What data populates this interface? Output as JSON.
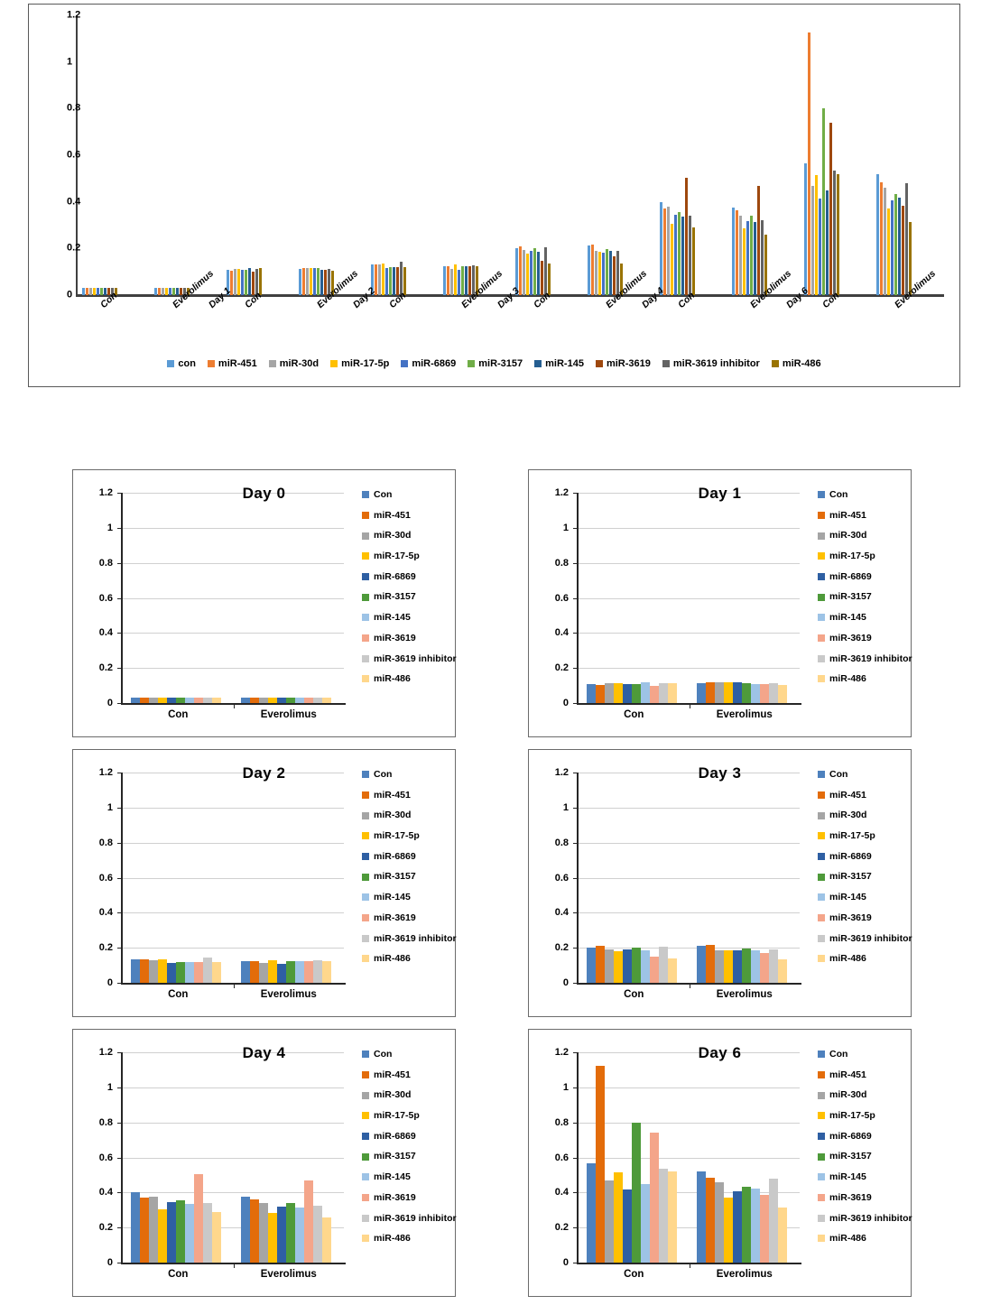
{
  "series_names_top": [
    "con",
    "miR-451",
    "miR-30d",
    "miR-17-5p",
    "miR-6869",
    "miR-3157",
    "miR-145",
    "miR-3619",
    "miR-3619 inhibitor",
    "miR-486"
  ],
  "series_names_sub": [
    "Con",
    "miR-451",
    "miR-30d",
    "miR-17-5p",
    "miR-6869",
    "miR-3157",
    "miR-145",
    "miR-3619",
    "miR-3619 inhibitor",
    "miR-486"
  ],
  "colors_top": [
    "#5B9BD5",
    "#ED7D31",
    "#A5A5A5",
    "#FFC000",
    "#4472C4",
    "#70AD47",
    "#255E91",
    "#9E480E",
    "#636363",
    "#997300"
  ],
  "colors_sub": [
    "#4E81BD",
    "#E36C0A",
    "#A5A5A5",
    "#FFC000",
    "#2E5FA3",
    "#4E9A3A",
    "#9DC3E6",
    "#F4A58A",
    "#C9C9C9",
    "#FFD78C"
  ],
  "y_ticks": [
    "0",
    "0.2",
    "0.4",
    "0.6",
    "0.8",
    "1",
    "1.2"
  ],
  "top_chart": {
    "x_labels": [
      "Con",
      "Everolimus",
      "Day 1",
      "Con",
      "Everolimus",
      "Day 2",
      "Con",
      "Everolimus",
      "Day 3",
      "Con",
      "Everolimus",
      "Day 4",
      "Con",
      "Everolimus",
      "Day 6",
      "Con",
      "Everolimus"
    ]
  },
  "chart_data": [
    {
      "type": "bar",
      "title": "",
      "xlabel": "",
      "ylabel": "",
      "ylim": [
        0,
        1.2
      ],
      "grid": false,
      "legend_position": "bottom",
      "categories": [
        "Day 0 Con",
        "Day 0 Everolimus",
        "Day 1 Con",
        "Day 1 Everolimus",
        "Day 2 Con",
        "Day 2 Everolimus",
        "Day 3 Con",
        "Day 3 Everolimus",
        "Day 4 Con",
        "Day 4 Everolimus",
        "Day 6 Con",
        "Day 6 Everolimus"
      ],
      "series": [
        {
          "name": "con",
          "values": [
            0.03,
            0.032,
            0.11,
            0.112,
            0.132,
            0.123,
            0.202,
            0.213,
            0.4,
            0.375,
            0.565,
            0.52
          ]
        },
        {
          "name": "miR-451",
          "values": [
            0.03,
            0.03,
            0.105,
            0.116,
            0.133,
            0.122,
            0.21,
            0.218,
            0.37,
            0.363,
            1.125,
            0.485
          ]
        },
        {
          "name": "miR-30d",
          "values": [
            0.031,
            0.031,
            0.112,
            0.116,
            0.131,
            0.112,
            0.193,
            0.188,
            0.378,
            0.34,
            0.47,
            0.46
          ]
        },
        {
          "name": "miR-17-5p",
          "values": [
            0.03,
            0.03,
            0.114,
            0.118,
            0.134,
            0.13,
            0.178,
            0.185,
            0.305,
            0.285,
            0.515,
            0.37
          ]
        },
        {
          "name": "miR-6869",
          "values": [
            0.031,
            0.031,
            0.108,
            0.118,
            0.115,
            0.108,
            0.19,
            0.183,
            0.345,
            0.318,
            0.415,
            0.405
          ]
        },
        {
          "name": "miR-3157",
          "values": [
            0.031,
            0.03,
            0.11,
            0.115,
            0.12,
            0.125,
            0.2,
            0.198,
            0.355,
            0.34,
            0.8,
            0.435
          ]
        },
        {
          "name": "miR-145",
          "values": [
            0.03,
            0.03,
            0.118,
            0.108,
            0.121,
            0.124,
            0.185,
            0.188,
            0.335,
            0.313,
            0.45,
            0.42
          ]
        },
        {
          "name": "miR-3619",
          "values": [
            0.03,
            0.031,
            0.1,
            0.11,
            0.12,
            0.124,
            0.148,
            0.168,
            0.505,
            0.468,
            0.74,
            0.385
          ]
        },
        {
          "name": "miR-3619 inhibitor",
          "values": [
            0.031,
            0.03,
            0.113,
            0.111,
            0.145,
            0.128,
            0.207,
            0.19,
            0.34,
            0.322,
            0.535,
            0.48
          ]
        },
        {
          "name": "miR-486",
          "values": [
            0.031,
            0.032,
            0.115,
            0.105,
            0.12,
            0.125,
            0.137,
            0.135,
            0.29,
            0.26,
            0.52,
            0.315
          ]
        }
      ]
    },
    {
      "type": "bar",
      "title": "Day 0",
      "ylim": [
        0,
        1.2
      ],
      "categories": [
        "Con",
        "Everolimus"
      ],
      "legend_position": "right",
      "grid": true,
      "series": [
        {
          "name": "Con",
          "values": [
            0.03,
            0.032
          ]
        },
        {
          "name": "miR-451",
          "values": [
            0.03,
            0.03
          ]
        },
        {
          "name": "miR-30d",
          "values": [
            0.031,
            0.031
          ]
        },
        {
          "name": "miR-17-5p",
          "values": [
            0.03,
            0.03
          ]
        },
        {
          "name": "miR-6869",
          "values": [
            0.031,
            0.031
          ]
        },
        {
          "name": "miR-3157",
          "values": [
            0.031,
            0.03
          ]
        },
        {
          "name": "miR-145",
          "values": [
            0.03,
            0.03
          ]
        },
        {
          "name": "miR-3619",
          "values": [
            0.03,
            0.031
          ]
        },
        {
          "name": "miR-3619 inhibitor",
          "values": [
            0.031,
            0.03
          ]
        },
        {
          "name": "miR-486",
          "values": [
            0.031,
            0.032
          ]
        }
      ]
    },
    {
      "type": "bar",
      "title": "Day 1",
      "ylim": [
        0,
        1.2
      ],
      "categories": [
        "Con",
        "Everolimus"
      ],
      "legend_position": "right",
      "grid": true,
      "series": [
        {
          "name": "Con",
          "values": [
            0.11,
            0.112
          ]
        },
        {
          "name": "miR-451",
          "values": [
            0.105,
            0.116
          ]
        },
        {
          "name": "miR-30d",
          "values": [
            0.112,
            0.116
          ]
        },
        {
          "name": "miR-17-5p",
          "values": [
            0.114,
            0.118
          ]
        },
        {
          "name": "miR-6869",
          "values": [
            0.108,
            0.118
          ]
        },
        {
          "name": "miR-3157",
          "values": [
            0.11,
            0.115
          ]
        },
        {
          "name": "miR-145",
          "values": [
            0.118,
            0.108
          ]
        },
        {
          "name": "miR-3619",
          "values": [
            0.1,
            0.11
          ]
        },
        {
          "name": "miR-3619 inhibitor",
          "values": [
            0.113,
            0.111
          ]
        },
        {
          "name": "miR-486",
          "values": [
            0.115,
            0.105
          ]
        }
      ]
    },
    {
      "type": "bar",
      "title": "Day 2",
      "ylim": [
        0,
        1.2
      ],
      "categories": [
        "Con",
        "Everolimus"
      ],
      "legend_position": "right",
      "grid": true,
      "series": [
        {
          "name": "Con",
          "values": [
            0.132,
            0.123
          ]
        },
        {
          "name": "miR-451",
          "values": [
            0.133,
            0.122
          ]
        },
        {
          "name": "miR-30d",
          "values": [
            0.131,
            0.112
          ]
        },
        {
          "name": "miR-17-5p",
          "values": [
            0.134,
            0.13
          ]
        },
        {
          "name": "miR-6869",
          "values": [
            0.115,
            0.108
          ]
        },
        {
          "name": "miR-3157",
          "values": [
            0.12,
            0.125
          ]
        },
        {
          "name": "miR-145",
          "values": [
            0.121,
            0.124
          ]
        },
        {
          "name": "miR-3619",
          "values": [
            0.12,
            0.124
          ]
        },
        {
          "name": "miR-3619 inhibitor",
          "values": [
            0.145,
            0.128
          ]
        },
        {
          "name": "miR-486",
          "values": [
            0.12,
            0.125
          ]
        }
      ]
    },
    {
      "type": "bar",
      "title": "Day 3",
      "ylim": [
        0,
        1.2
      ],
      "categories": [
        "Con",
        "Everolimus"
      ],
      "legend_position": "right",
      "grid": true,
      "series": [
        {
          "name": "Con",
          "values": [
            0.202,
            0.213
          ]
        },
        {
          "name": "miR-451",
          "values": [
            0.21,
            0.218
          ]
        },
        {
          "name": "miR-30d",
          "values": [
            0.193,
            0.188
          ]
        },
        {
          "name": "miR-17-5p",
          "values": [
            0.178,
            0.185
          ]
        },
        {
          "name": "miR-6869",
          "values": [
            0.19,
            0.183
          ]
        },
        {
          "name": "miR-3157",
          "values": [
            0.2,
            0.198
          ]
        },
        {
          "name": "miR-145",
          "values": [
            0.185,
            0.188
          ]
        },
        {
          "name": "miR-3619",
          "values": [
            0.148,
            0.168
          ]
        },
        {
          "name": "miR-3619 inhibitor",
          "values": [
            0.207,
            0.19
          ]
        },
        {
          "name": "miR-486",
          "values": [
            0.137,
            0.135
          ]
        }
      ]
    },
    {
      "type": "bar",
      "title": "Day 4",
      "ylim": [
        0,
        1.2
      ],
      "categories": [
        "Con",
        "Everolimus"
      ],
      "legend_position": "right",
      "grid": true,
      "series": [
        {
          "name": "Con",
          "values": [
            0.4,
            0.375
          ]
        },
        {
          "name": "miR-451",
          "values": [
            0.37,
            0.363
          ]
        },
        {
          "name": "miR-30d",
          "values": [
            0.378,
            0.34
          ]
        },
        {
          "name": "miR-17-5p",
          "values": [
            0.305,
            0.285
          ]
        },
        {
          "name": "miR-6869",
          "values": [
            0.345,
            0.318
          ]
        },
        {
          "name": "miR-3157",
          "values": [
            0.355,
            0.34
          ]
        },
        {
          "name": "miR-145",
          "values": [
            0.335,
            0.313
          ]
        },
        {
          "name": "miR-3619",
          "values": [
            0.505,
            0.468
          ]
        },
        {
          "name": "miR-3619 inhibitor",
          "values": [
            0.34,
            0.322
          ]
        },
        {
          "name": "miR-486",
          "values": [
            0.29,
            0.26
          ]
        }
      ]
    },
    {
      "type": "bar",
      "title": "Day 6",
      "ylim": [
        0,
        1.2
      ],
      "categories": [
        "Con",
        "Everolimus"
      ],
      "legend_position": "right",
      "grid": true,
      "series": [
        {
          "name": "Con",
          "values": [
            0.565,
            0.52
          ]
        },
        {
          "name": "miR-451",
          "values": [
            1.125,
            0.485
          ]
        },
        {
          "name": "miR-30d",
          "values": [
            0.47,
            0.46
          ]
        },
        {
          "name": "miR-17-5p",
          "values": [
            0.515,
            0.37
          ]
        },
        {
          "name": "miR-6869",
          "values": [
            0.415,
            0.405
          ]
        },
        {
          "name": "miR-3157",
          "values": [
            0.8,
            0.435
          ]
        },
        {
          "name": "miR-145",
          "values": [
            0.45,
            0.42
          ]
        },
        {
          "name": "miR-3619",
          "values": [
            0.74,
            0.385
          ]
        },
        {
          "name": "miR-3619 inhibitor",
          "values": [
            0.535,
            0.48
          ]
        },
        {
          "name": "miR-486",
          "values": [
            0.52,
            0.315
          ]
        }
      ]
    }
  ]
}
